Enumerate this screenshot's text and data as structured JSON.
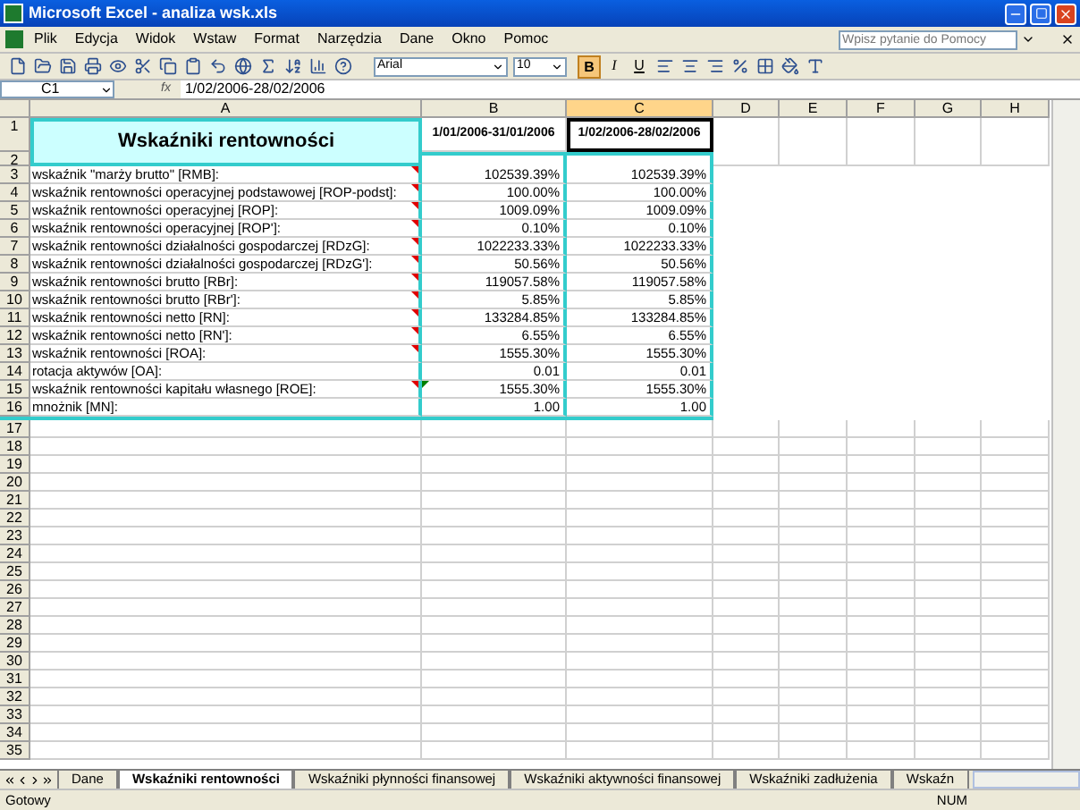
{
  "window": {
    "title": "Microsoft Excel - analiza wsk.xls"
  },
  "menu": [
    "Plik",
    "Edycja",
    "Widok",
    "Wstaw",
    "Format",
    "Narzędzia",
    "Dane",
    "Okno",
    "Pomoc"
  ],
  "help_box": {
    "placeholder": "Wpisz pytanie do Pomocy"
  },
  "format_toolbar": {
    "font": "Arial",
    "size": "10",
    "style_buttons": [
      {
        "label": "B",
        "kind": "bold",
        "on": true
      },
      {
        "label": "I",
        "kind": "italic",
        "on": false
      },
      {
        "label": "U",
        "kind": "underline",
        "on": false
      }
    ]
  },
  "formula_bar": {
    "name_box": "C1",
    "fx": "fx",
    "formula": "1/02/2006-28/02/2006"
  },
  "columns": [
    {
      "label": "A",
      "selected": false
    },
    {
      "label": "B",
      "selected": false
    },
    {
      "label": "C",
      "selected": true
    },
    {
      "label": "D",
      "selected": false
    },
    {
      "label": "E",
      "selected": false
    },
    {
      "label": "F",
      "selected": false
    },
    {
      "label": "G",
      "selected": false
    },
    {
      "label": "H",
      "selected": false
    }
  ],
  "title_cell": "Wskaźniki rentowności",
  "period_headers": [
    "1/01/2006-31/01/2006",
    "1/02/2006-28/02/2006"
  ],
  "rows": [
    {
      "n": "3",
      "label": "wskaźnik \"marży brutto\" [RMB]:",
      "b": "102539.39%",
      "c": "102539.39%",
      "comment": true,
      "error_flag": false
    },
    {
      "n": "4",
      "label": "wskaźnik rentowności operacyjnej podstawowej [ROP-podst]:",
      "b": "100.00%",
      "c": "100.00%",
      "comment": true,
      "error_flag": false
    },
    {
      "n": "5",
      "label": "wskaźnik rentowności operacyjnej [ROP]:",
      "b": "1009.09%",
      "c": "1009.09%",
      "comment": true,
      "error_flag": false
    },
    {
      "n": "6",
      "label": "wskaźnik rentowności operacyjnej [ROP']:",
      "b": "0.10%",
      "c": "0.10%",
      "comment": true,
      "error_flag": false
    },
    {
      "n": "7",
      "label": "wskaźnik rentowności działalności gospodarczej [RDzG]:",
      "b": "1022233.33%",
      "c": "1022233.33%",
      "comment": true,
      "error_flag": false
    },
    {
      "n": "8",
      "label": "wskaźnik rentowności działalności gospodarczej [RDzG']:",
      "b": "50.56%",
      "c": "50.56%",
      "comment": true,
      "error_flag": false
    },
    {
      "n": "9",
      "label": "wskaźnik rentowności brutto [RBr]:",
      "b": "119057.58%",
      "c": "119057.58%",
      "comment": true,
      "error_flag": false
    },
    {
      "n": "10",
      "label": "wskaźnik rentowności brutto [RBr']:",
      "b": "5.85%",
      "c": "5.85%",
      "comment": true,
      "error_flag": false
    },
    {
      "n": "11",
      "label": "wskaźnik rentowności netto [RN]:",
      "b": "133284.85%",
      "c": "133284.85%",
      "comment": true,
      "error_flag": false
    },
    {
      "n": "12",
      "label": "wskaźnik rentowności netto [RN']:",
      "b": "6.55%",
      "c": "6.55%",
      "comment": true,
      "error_flag": false
    },
    {
      "n": "13",
      "label": "wskaźnik rentowności [ROA]:",
      "b": "1555.30%",
      "c": "1555.30%",
      "comment": true,
      "error_flag": false
    },
    {
      "n": "14",
      "label": "rotacja aktywów [OA]:",
      "b": "0.01",
      "c": "0.01",
      "comment": false,
      "error_flag": false
    },
    {
      "n": "15",
      "label": "wskaźnik rentowności kapitału własnego [ROE]:",
      "b": "1555.30%",
      "c": "1555.30%",
      "comment": true,
      "error_flag": true
    },
    {
      "n": "16",
      "label": "mnożnik [MN]:",
      "b": "1.00",
      "c": "1.00",
      "comment": false,
      "error_flag": false
    }
  ],
  "row_numbers": [
    "1",
    "2"
  ],
  "empty_rows": [
    "17",
    "18",
    "19",
    "20",
    "21",
    "22",
    "23",
    "24",
    "25",
    "26",
    "27",
    "28",
    "29",
    "30",
    "31",
    "32",
    "33",
    "34",
    "35"
  ],
  "sheet_tabs": [
    {
      "label": "Dane",
      "selected": false
    },
    {
      "label": "Wskaźniki rentowności",
      "selected": true
    },
    {
      "label": "Wskaźniki płynności finansowej",
      "selected": false
    },
    {
      "label": "Wskaźniki aktywności finansowej",
      "selected": false
    },
    {
      "label": "Wskaźniki zadłużenia",
      "selected": false
    },
    {
      "label": "Wskaźn",
      "selected": false
    }
  ],
  "status_bar": {
    "text": "Gotowy",
    "num": "NUM"
  }
}
